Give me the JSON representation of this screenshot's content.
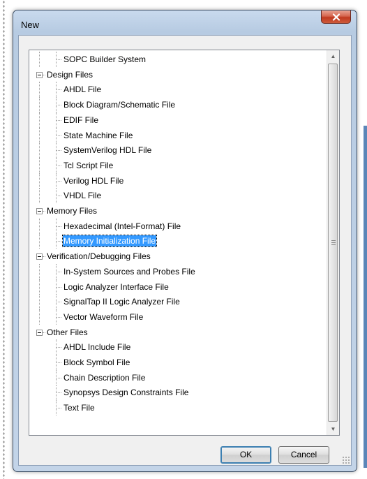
{
  "dialog": {
    "title": "New",
    "close_icon": "close-x-icon"
  },
  "tree": {
    "items": [
      {
        "label": "SOPC Builder System",
        "level": 1,
        "expander": false
      },
      {
        "label": "Design Files",
        "level": 0,
        "expander": true
      },
      {
        "label": "AHDL File",
        "level": 1,
        "expander": false
      },
      {
        "label": "Block Diagram/Schematic File",
        "level": 1,
        "expander": false
      },
      {
        "label": "EDIF File",
        "level": 1,
        "expander": false
      },
      {
        "label": "State Machine File",
        "level": 1,
        "expander": false
      },
      {
        "label": "SystemVerilog HDL File",
        "level": 1,
        "expander": false
      },
      {
        "label": "Tcl Script File",
        "level": 1,
        "expander": false
      },
      {
        "label": "Verilog HDL File",
        "level": 1,
        "expander": false
      },
      {
        "label": "VHDL File",
        "level": 1,
        "expander": false
      },
      {
        "label": "Memory Files",
        "level": 0,
        "expander": true
      },
      {
        "label": "Hexadecimal (Intel-Format) File",
        "level": 1,
        "expander": false
      },
      {
        "label": "Memory Initialization File",
        "level": 1,
        "expander": false,
        "selected": true
      },
      {
        "label": "Verification/Debugging Files",
        "level": 0,
        "expander": true
      },
      {
        "label": "In-System Sources and Probes File",
        "level": 1,
        "expander": false
      },
      {
        "label": "Logic Analyzer Interface File",
        "level": 1,
        "expander": false
      },
      {
        "label": "SignalTap II Logic Analyzer File",
        "level": 1,
        "expander": false
      },
      {
        "label": "Vector Waveform File",
        "level": 1,
        "expander": false
      },
      {
        "label": "Other Files",
        "level": 0,
        "expander": true
      },
      {
        "label": "AHDL Include File",
        "level": 1,
        "expander": false
      },
      {
        "label": "Block Symbol File",
        "level": 1,
        "expander": false
      },
      {
        "label": "Chain Description File",
        "level": 1,
        "expander": false
      },
      {
        "label": "Synopsys Design Constraints File",
        "level": 1,
        "expander": false
      },
      {
        "label": "Text File",
        "level": 1,
        "expander": false
      }
    ],
    "selected_item": "Memory Initialization File"
  },
  "buttons": {
    "ok_label": "OK",
    "cancel_label": "Cancel"
  },
  "colors": {
    "selection": "#3399ff",
    "close_button": "#c0391f",
    "frame": "#b7cbe2"
  }
}
